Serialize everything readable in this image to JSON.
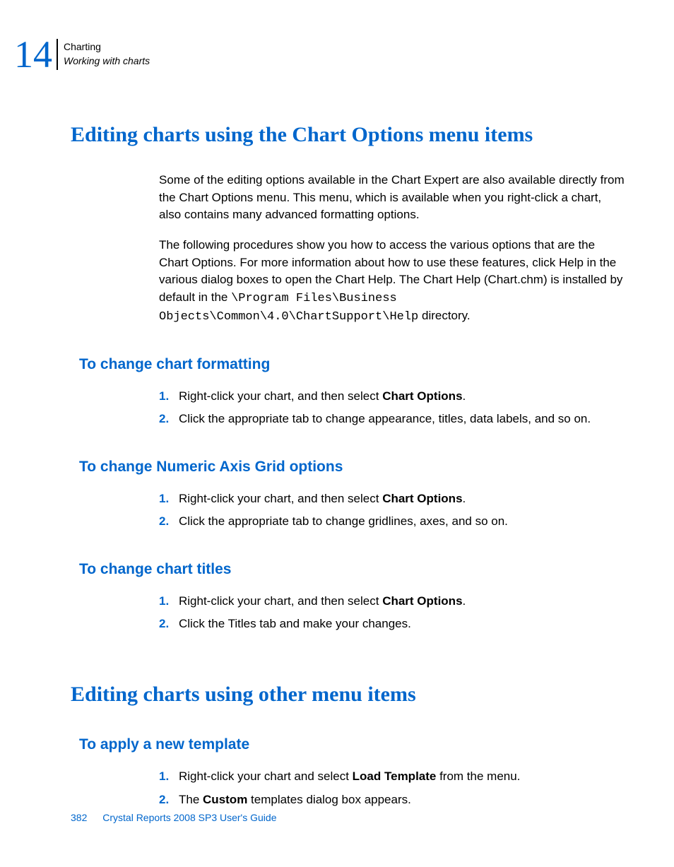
{
  "header": {
    "chapter_number": "14",
    "chapter_title": "Charting",
    "section_title": "Working with charts"
  },
  "section1": {
    "title": "Editing charts using the Chart Options menu items",
    "para1": "Some of the editing options available in the Chart Expert are also available directly from the Chart Options menu. This menu, which is available when you right-click a chart, also contains many advanced formatting options.",
    "para2_pre": "The following procedures show you how to access the various options that are the Chart Options. For more information about how to use these features, click Help in the various dialog boxes to open the Chart Help. The Chart Help (Chart.chm) is installed by default in the ",
    "para2_code": "\\Program Files\\Business Objects\\Common\\4.0\\ChartSupport\\Help",
    "para2_post": " directory.",
    "sub1": {
      "title": "To change chart formatting",
      "step1_num": "1.",
      "step1_pre": "Right-click your chart, and then select ",
      "step1_bold": "Chart Options",
      "step1_post": ".",
      "step2_num": "2.",
      "step2_text": "Click the appropriate tab to change appearance, titles, data labels, and so on."
    },
    "sub2": {
      "title": "To change Numeric Axis Grid options",
      "step1_num": "1.",
      "step1_pre": "Right-click your chart, and then select ",
      "step1_bold": "Chart Options",
      "step1_post": ".",
      "step2_num": "2.",
      "step2_text": "Click the appropriate tab to change gridlines, axes, and so on."
    },
    "sub3": {
      "title": "To change chart titles",
      "step1_num": "1.",
      "step1_pre": "Right-click your chart, and then select ",
      "step1_bold": "Chart Options",
      "step1_post": ".",
      "step2_num": "2.",
      "step2_text": "Click the Titles tab and make your changes."
    }
  },
  "section2": {
    "title": "Editing charts using other menu items",
    "sub1": {
      "title": "To apply a new template",
      "step1_num": "1.",
      "step1_pre": "Right-click your chart and select ",
      "step1_bold": "Load Template",
      "step1_post": " from the menu.",
      "step2_num": "2.",
      "step2_pre": "The ",
      "step2_bold": "Custom",
      "step2_post": " templates dialog box appears."
    }
  },
  "footer": {
    "page_number": "382",
    "guide_title": "Crystal Reports 2008 SP3 User's Guide"
  }
}
